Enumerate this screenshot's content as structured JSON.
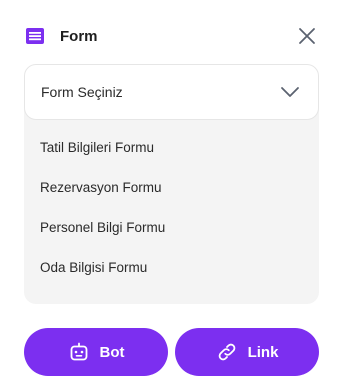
{
  "header": {
    "title": "Form",
    "icon": "form-list-icon",
    "close_icon": "close-icon"
  },
  "select": {
    "label": "Form Seçiniz",
    "icon": "chevron-down-icon",
    "options": [
      "Tatil Bilgileri Formu",
      "Rezervasyon Formu",
      "Personel Bilgi Formu",
      "Oda Bilgisi Formu"
    ]
  },
  "actions": {
    "bot_label": "Bot",
    "bot_icon": "robot-icon",
    "link_label": "Link",
    "link_icon": "link-icon"
  },
  "colors": {
    "accent": "#7c2ff0",
    "panel_bg": "#f4f4f4",
    "close_icon": "#5b6270"
  }
}
